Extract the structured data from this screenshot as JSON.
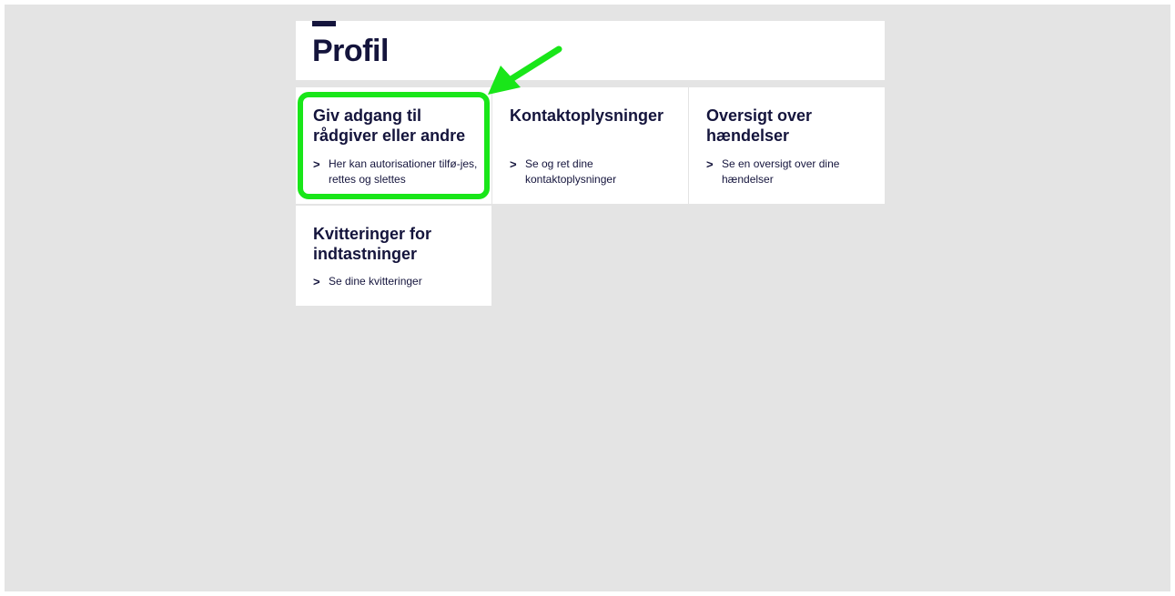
{
  "page": {
    "title": "Profil"
  },
  "cards": [
    {
      "title": "Giv adgang til rådgiver eller andre",
      "link": "Her kan autorisationer tilfø-jes, rettes og slettes"
    },
    {
      "title": "Kontaktoplysninger",
      "link": "Se og ret dine kontaktoplysninger"
    },
    {
      "title": "Oversigt over hændelser",
      "link": "Se en oversigt over dine hændelser"
    },
    {
      "title": "Kvitteringer for indtastninger",
      "link": "Se dine kvitteringer"
    }
  ],
  "colors": {
    "highlight": "#19e619",
    "text": "#14143c",
    "background": "#e4e4e4"
  },
  "icons": {
    "link": "chevron-right-icon",
    "annotation": "arrow-icon"
  }
}
